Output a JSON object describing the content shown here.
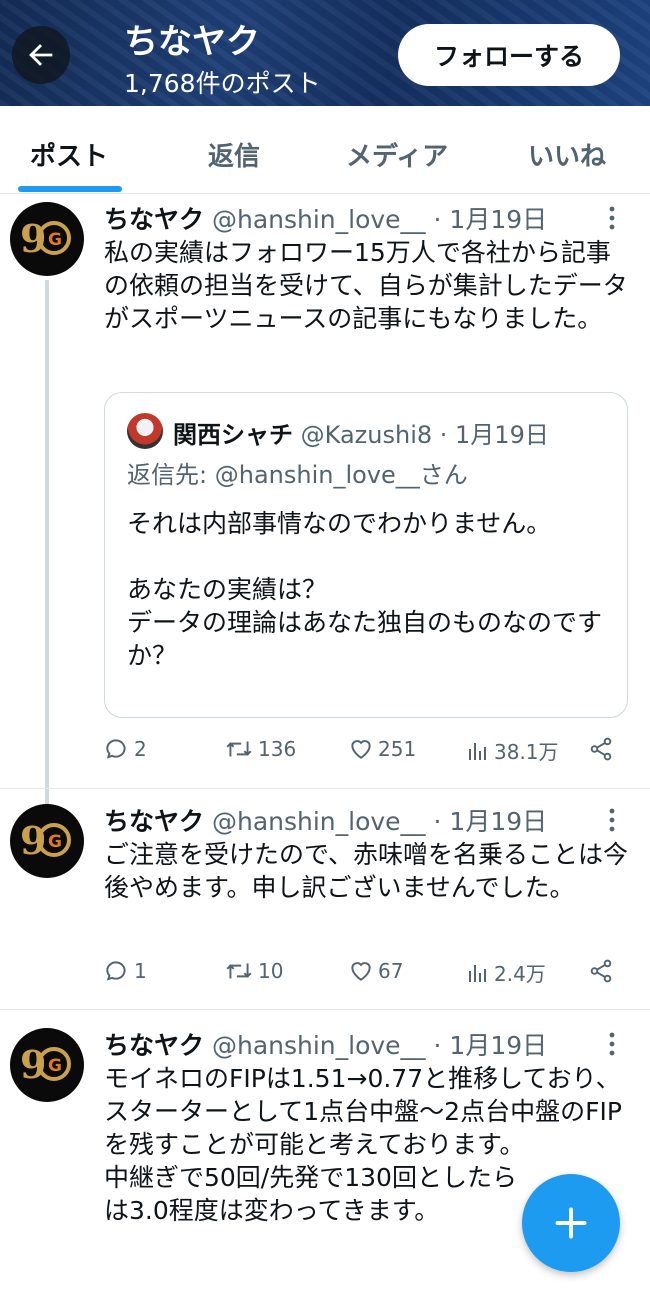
{
  "header": {
    "name": "ちなヤク",
    "post_count": "1,768件のポスト",
    "follow_label": "フォローする"
  },
  "tabs": [
    {
      "label": "ポスト",
      "active": true
    },
    {
      "label": "返信",
      "active": false
    },
    {
      "label": "メディア",
      "active": false
    },
    {
      "label": "いいね",
      "active": false
    }
  ],
  "tweets": [
    {
      "name": "ちなヤク",
      "handle": "@hanshin_love__",
      "date": "1月19日",
      "text": "私の実績はフォロワー15万人で各社から記事の依頼の担当を受けて、自らが集計したデータがスポーツニュースの記事にもなりました。",
      "quote": {
        "name": "関西シャチ",
        "handle": "@Kazushi8",
        "date": "1月19日",
        "reply_prefix": "返信先:",
        "reply_handle": "@hanshin_love__さん",
        "text": "それは内部事情なのでわかりません。\n\nあなたの実績は？\nデータの理論はあなた独自のものなのですか？"
      },
      "replies": "2",
      "reposts": "136",
      "likes": "251",
      "views": "38.1万"
    },
    {
      "name": "ちなヤク",
      "handle": "@hanshin_love__",
      "date": "1月19日",
      "text": "ご注意を受けたので、赤味噌を名乗ることは今後やめます。申し訳ございませんでした。",
      "replies": "1",
      "reposts": "10",
      "likes": "67",
      "views": "2.4万"
    },
    {
      "name": "ちなヤク",
      "handle": "@hanshin_love__",
      "date": "1月19日",
      "text": "モイネロのFIPは1.51→0.77と推移しており、スターターとして1点台中盤〜2点台中盤のFIPを残すことが可能と考えております。\n中継ぎで50回/先発で130回としたら\nは3.0程度は変わってきます。"
    }
  ],
  "icons": {
    "back": "arrow-left-icon",
    "more": "more-vertical-icon",
    "reply": "reply-icon",
    "repost": "repost-icon",
    "like": "heart-icon",
    "views": "views-icon",
    "share": "share-icon",
    "compose": "plus-icon"
  },
  "colors": {
    "accent": "#1d9bf0",
    "text": "#0f1419",
    "muted": "#536471"
  }
}
